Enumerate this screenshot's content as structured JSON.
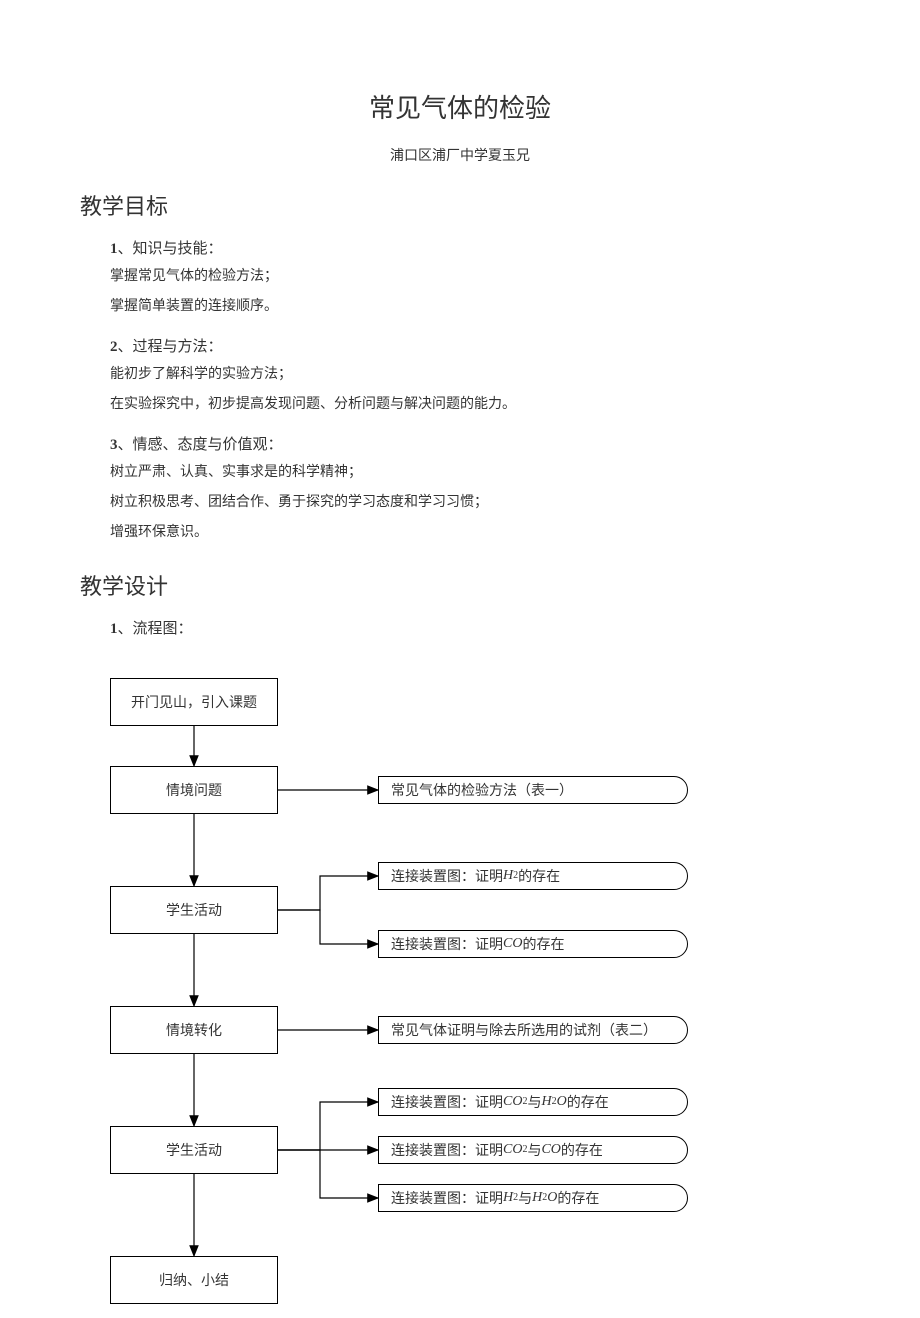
{
  "title": "常见气体的检验",
  "subtitle": "浦口区浦厂中学夏玉兄",
  "sections": {
    "goal": {
      "heading": "教学目标",
      "items": [
        {
          "num": "1",
          "head": "知识与技能：",
          "lines": [
            "掌握常见气体的检验方法；",
            "掌握简单装置的连接顺序。"
          ]
        },
        {
          "num": "2",
          "head": "过程与方法：",
          "lines": [
            "能初步了解科学的实验方法；",
            "在实验探究中，初步提高发现问题、分析问题与解决问题的能力。"
          ]
        },
        {
          "num": "3",
          "head": "情感、态度与价值观：",
          "lines": [
            "树立严肃、认真、实事求是的科学精神；",
            "树立积极思考、团结合作、勇于探究的学习态度和学习习惯；",
            "增强环保意识。"
          ]
        }
      ]
    },
    "design": {
      "heading": "教学设计",
      "items": [
        {
          "num": "1",
          "head": "流程图："
        }
      ]
    }
  },
  "chart_data": {
    "type": "flowchart",
    "left_nodes": [
      {
        "id": "n0",
        "label": "开门见山，引入课题"
      },
      {
        "id": "n1",
        "label": "情境问题"
      },
      {
        "id": "n2",
        "label": "学生活动"
      },
      {
        "id": "n3",
        "label": "情境转化"
      },
      {
        "id": "n4",
        "label": "学生活动"
      },
      {
        "id": "n5",
        "label": "归纳、小结"
      }
    ],
    "right_nodes": [
      {
        "id": "r1",
        "from": "n1",
        "label_pre": "常见气体的检验方法（表一）"
      },
      {
        "id": "r2a",
        "from": "n2",
        "label_pre": "连接装置图：证明",
        "formula": "H₂",
        "label_post": "的存在"
      },
      {
        "id": "r2b",
        "from": "n2",
        "label_pre": "连接装置图：证明",
        "formula": "CO",
        "label_post": "的存在"
      },
      {
        "id": "r3",
        "from": "n3",
        "label_pre": "常见气体证明与除去所选用的试剂（表二）"
      },
      {
        "id": "r4a",
        "from": "n4",
        "label_pre": "连接装置图：证明",
        "formula": "CO₂与H₂O",
        "label_post": "的存在"
      },
      {
        "id": "r4b",
        "from": "n4",
        "label_pre": "连接装置图：证明",
        "formula": "CO₂与CO",
        "label_post": "的存在"
      },
      {
        "id": "r4c",
        "from": "n4",
        "label_pre": "连接装置图：证明",
        "formula": "H₂与H₂O",
        "label_post": "的存在"
      }
    ],
    "vertical_flow": [
      "n0",
      "n1",
      "n2",
      "n3",
      "n4",
      "n5"
    ]
  }
}
